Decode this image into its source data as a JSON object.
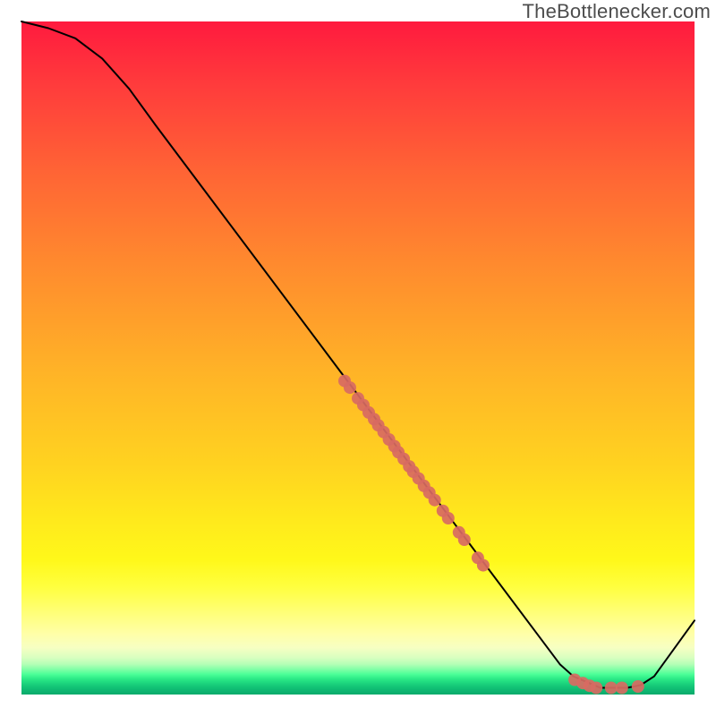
{
  "watermark": "TheBottlenecker.com",
  "chart_data": {
    "type": "line",
    "title": "",
    "xlabel": "",
    "ylabel": "",
    "xlim": [
      0,
      100
    ],
    "ylim": [
      0,
      100
    ],
    "series": [
      {
        "name": "curve",
        "x": [
          0,
          4,
          8,
          12,
          16,
          20,
          80,
          82,
          86,
          90,
          92,
          94,
          100
        ],
        "y": [
          100,
          99,
          97.5,
          94.5,
          90,
          84.5,
          4.5,
          2.7,
          1.0,
          1.0,
          1.4,
          2.7,
          11
        ],
        "stroke": "#000000",
        "stroke_width": 2
      }
    ],
    "scatter": [
      {
        "name": "upper-cluster",
        "color": "#d86a62",
        "radius": 7,
        "points": [
          {
            "x": 48.0,
            "y": 46.6
          },
          {
            "x": 48.8,
            "y": 45.6
          },
          {
            "x": 50.0,
            "y": 44.0
          },
          {
            "x": 50.8,
            "y": 43.0
          },
          {
            "x": 51.6,
            "y": 41.9
          },
          {
            "x": 52.4,
            "y": 40.9
          },
          {
            "x": 53.0,
            "y": 40.0
          },
          {
            "x": 53.8,
            "y": 39.0
          },
          {
            "x": 54.6,
            "y": 37.9
          },
          {
            "x": 55.4,
            "y": 36.9
          },
          {
            "x": 56.0,
            "y": 36.0
          },
          {
            "x": 56.8,
            "y": 35.0
          },
          {
            "x": 57.6,
            "y": 33.9
          },
          {
            "x": 58.2,
            "y": 33.1
          },
          {
            "x": 59.0,
            "y": 32.1
          },
          {
            "x": 59.8,
            "y": 31.0
          },
          {
            "x": 60.6,
            "y": 30.0
          },
          {
            "x": 61.4,
            "y": 28.9
          },
          {
            "x": 62.6,
            "y": 27.3
          },
          {
            "x": 63.4,
            "y": 26.2
          },
          {
            "x": 65.0,
            "y": 24.1
          },
          {
            "x": 65.8,
            "y": 23.0
          },
          {
            "x": 67.8,
            "y": 20.3
          },
          {
            "x": 68.6,
            "y": 19.2
          }
        ]
      },
      {
        "name": "bottom-cluster",
        "color": "#d86a62",
        "radius": 7,
        "points": [
          {
            "x": 82.2,
            "y": 2.2
          },
          {
            "x": 83.4,
            "y": 1.7
          },
          {
            "x": 84.4,
            "y": 1.3
          },
          {
            "x": 85.4,
            "y": 1.0
          },
          {
            "x": 87.6,
            "y": 1.0
          },
          {
            "x": 89.2,
            "y": 1.0
          },
          {
            "x": 91.6,
            "y": 1.2
          }
        ]
      }
    ]
  }
}
